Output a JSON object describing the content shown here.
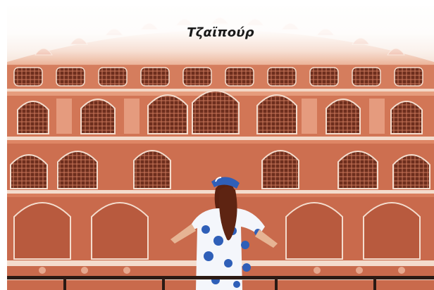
{
  "destination": {
    "title": "Τζαϊπούρ"
  },
  "colors": {
    "facade_main": "#d9785a",
    "facade_light": "#efb39a",
    "trim": "#f4dccd",
    "window_dark": "#7a3522",
    "dress_blue": "#2f5fb8",
    "hair": "#5a2010"
  }
}
